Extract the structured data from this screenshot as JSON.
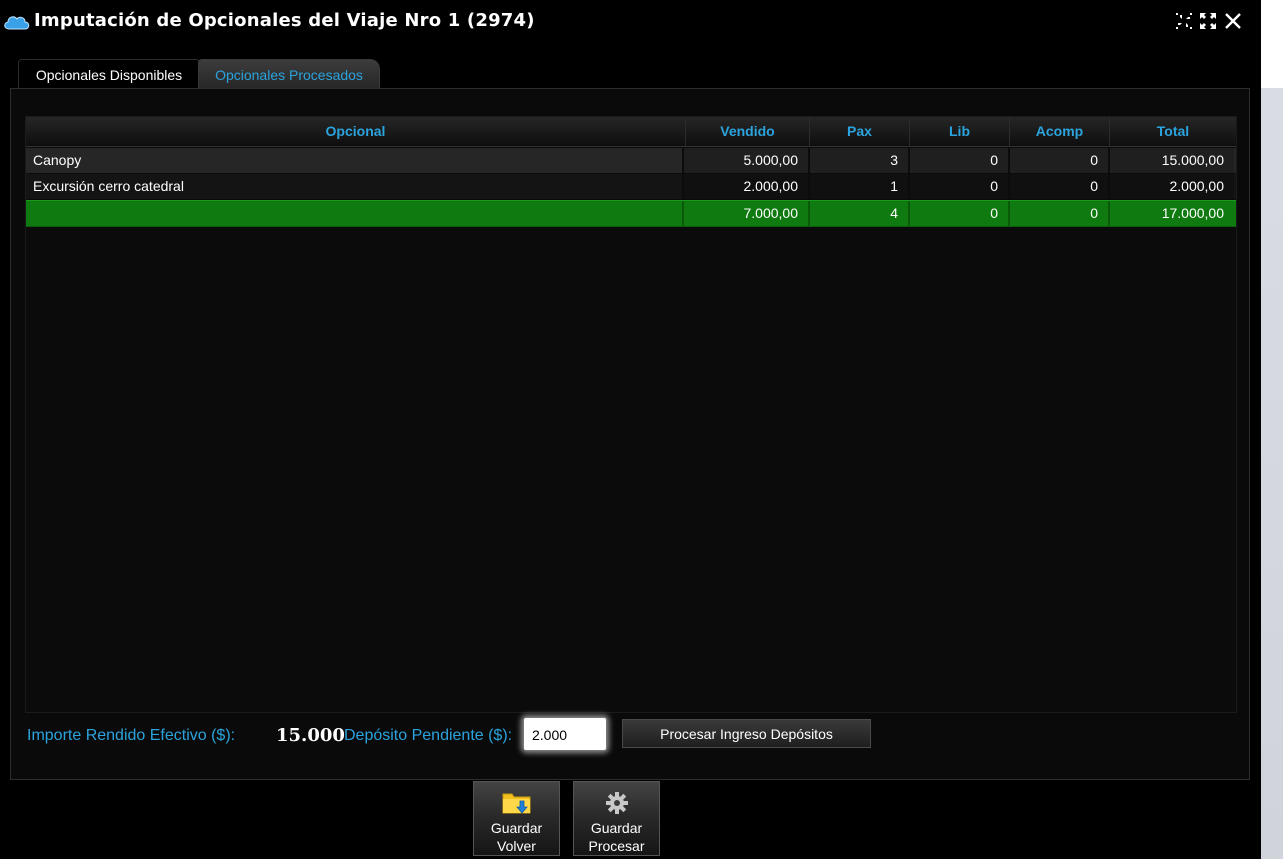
{
  "window": {
    "title": "Imputación de Opcionales del Viaje Nro 1 (2974)",
    "icon": "cloud-icon",
    "controls": [
      "collapse-icon",
      "expand-icon",
      "close-icon"
    ]
  },
  "tabs": [
    {
      "label": "Opcionales Disponibles",
      "active": true
    },
    {
      "label": "Opcionales Procesados",
      "active": false
    }
  ],
  "table": {
    "columns": [
      "Opcional",
      "Vendido",
      "Pax",
      "Lib",
      "Acomp",
      "Total"
    ],
    "rows": [
      {
        "opcional": "Canopy",
        "vendido": "5.000,00",
        "pax": "3",
        "lib": "0",
        "acomp": "0",
        "total": "15.000,00"
      },
      {
        "opcional": "Excursión cerro catedral",
        "vendido": "2.000,00",
        "pax": "1",
        "lib": "0",
        "acomp": "0",
        "total": "2.000,00"
      }
    ],
    "totals": {
      "opcional": "",
      "vendido": "7.000,00",
      "pax": "4",
      "lib": "0",
      "acomp": "0",
      "total": "17.000,00"
    }
  },
  "footer": {
    "importe_label": "Importe Rendido Efectivo ($):",
    "importe_value": "15.000",
    "deposito_label": "Depósito Pendiente ($):",
    "deposito_value": "2.000",
    "procesar_button": "Procesar Ingreso Depósitos"
  },
  "actions": {
    "guardar_volver": {
      "line1": "Guardar",
      "line2": "Volver",
      "icon": "folder-download-icon"
    },
    "guardar_procesar": {
      "line1": "Guardar",
      "line2": "Procesar",
      "icon": "gear-icon"
    }
  },
  "colors": {
    "accent": "#2ba3dd",
    "total_row": "#0f7a0f",
    "background": "#000000"
  }
}
